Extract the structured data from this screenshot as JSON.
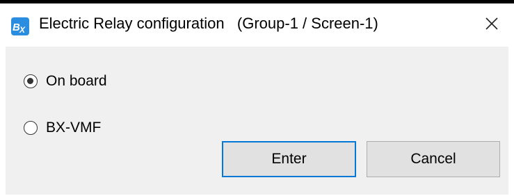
{
  "window": {
    "title": "Electric Relay configuration   (Group-1 / Screen-1)",
    "icon": "bx-app-icon",
    "icon_text": "BX",
    "close_icon": "close-icon",
    "accent_color": "#0078d7",
    "icon_color": "#2a8de0"
  },
  "options": {
    "on_board": {
      "label": "On board",
      "checked": true
    },
    "bx_vmf": {
      "label": "BX-VMF",
      "checked": false
    }
  },
  "buttons": {
    "enter_label": "Enter",
    "cancel_label": "Cancel"
  }
}
